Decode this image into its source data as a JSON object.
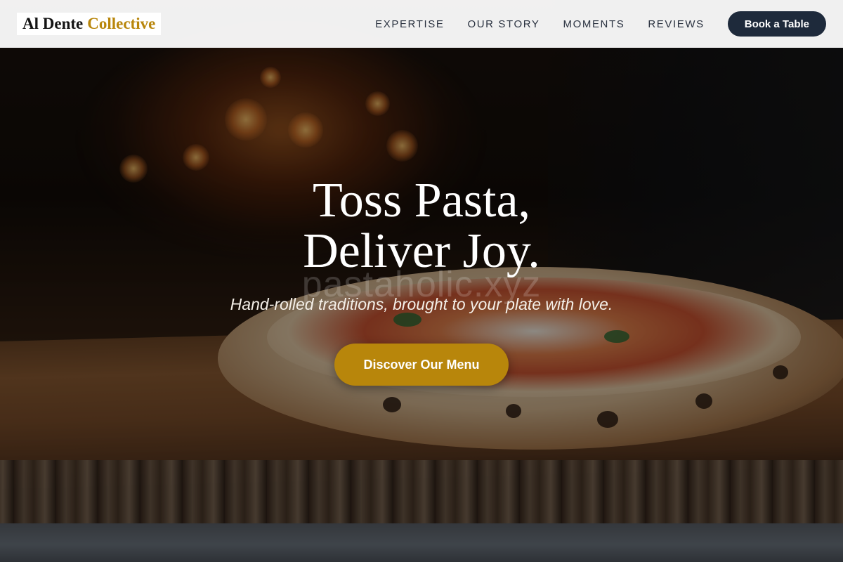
{
  "brand": {
    "name_primary": "Al Dente",
    "name_accent": "Collective"
  },
  "nav": {
    "links": [
      "EXPERTISE",
      "OUR STORY",
      "MOMENTS",
      "REVIEWS"
    ],
    "cta_label": "Book a Table"
  },
  "hero": {
    "title_line1": "Toss Pasta,",
    "title_line2": "Deliver Joy.",
    "watermark": "pastaholic.xyz",
    "subtitle": "Hand-rolled traditions, brought to your plate with love.",
    "cta_label": "Discover Our Menu"
  },
  "colors": {
    "accent_gold": "#b8860b",
    "navy": "#1e2a3b",
    "nav_text": "#2a3240"
  }
}
